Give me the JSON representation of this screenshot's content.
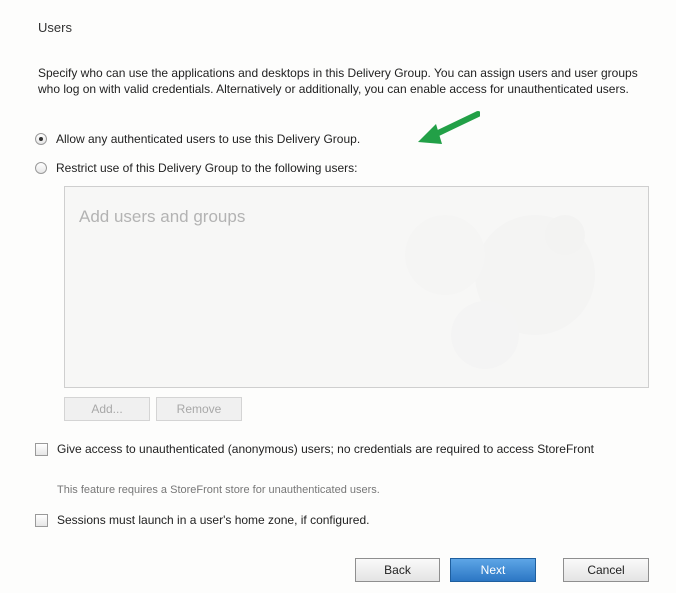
{
  "section": {
    "title": "Users",
    "description": "Specify who can use the applications and desktops in this Delivery Group. You can assign users and user groups who log on with valid credentials. Alternatively or additionally, you can enable access for unauthenticated users."
  },
  "options": {
    "allow_any": {
      "label": "Allow any authenticated users to use this Delivery Group.",
      "selected": true
    },
    "restrict": {
      "label": "Restrict use of this Delivery Group to the following users:",
      "selected": false
    }
  },
  "users_list": {
    "placeholder": "Add users and groups"
  },
  "list_buttons": {
    "add_label": "Add...",
    "remove_label": "Remove"
  },
  "checkboxes": {
    "unauthenticated": {
      "label": "Give access to unauthenticated (anonymous) users; no credentials are required to access StoreFront",
      "note": "This feature requires a StoreFront store for unauthenticated users.",
      "checked": false
    },
    "home_zone": {
      "label": "Sessions must launch in a user's home zone, if configured.",
      "checked": false
    }
  },
  "footer": {
    "back_label": "Back",
    "next_label": "Next",
    "cancel_label": "Cancel"
  },
  "colors": {
    "accent": "#2c77c4",
    "annotation_arrow": "#22a047"
  }
}
